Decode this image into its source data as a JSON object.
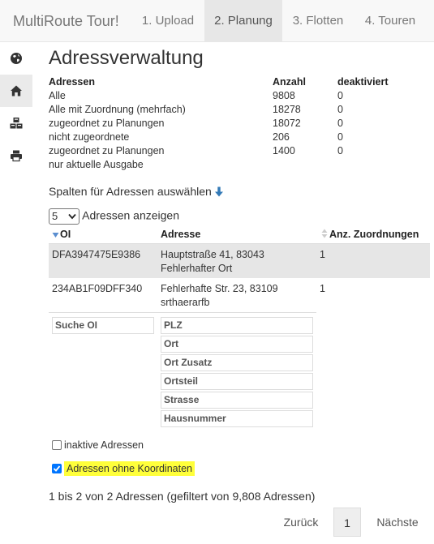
{
  "navbar": {
    "brand": "MultiRoute Tour!",
    "tabs": [
      "1. Upload",
      "2. Planung",
      "3. Flotten",
      "4. Touren"
    ],
    "active_tab": 1
  },
  "sidebar": {
    "items": [
      "globe-icon",
      "home-icon",
      "cubes-icon",
      "print-icon"
    ],
    "active_item": 1
  },
  "page": {
    "title": "Adressverwaltung"
  },
  "summary": {
    "headers": [
      "Adressen",
      "Anzahl",
      "deaktiviert"
    ],
    "rows": [
      [
        "Alle",
        "9808",
        "0"
      ],
      [
        "Alle mit Zuordnung (mehrfach)",
        "18278",
        "0"
      ],
      [
        "zugeordnet zu Planungen",
        "18072",
        "0"
      ],
      [
        "nicht zugeordnete",
        "206",
        "0"
      ],
      [
        "zugeordnet zu Planungen",
        "1400",
        "0"
      ],
      [
        "nur aktuelle Ausgabe",
        "",
        ""
      ]
    ]
  },
  "columns_selector": {
    "label": "Spalten für Adressen auswählen"
  },
  "length_control": {
    "value": "5",
    "label": "Adressen anzeigen"
  },
  "table": {
    "headers": [
      "OI",
      "Adresse",
      "Anz. Zuordnungen"
    ],
    "rows": [
      {
        "oi": "DFA3947475E9386",
        "address_line1": "Hauptstraße 41, 83043",
        "address_line2": "Fehlerhafter Ort",
        "count": "1"
      },
      {
        "oi": "234AB1F09DFF340",
        "address_line1": "Fehlerhafte Str. 23, 83109",
        "address_line2": "srthaerarfb",
        "count": "1"
      }
    ],
    "filters": {
      "oi_placeholder": "Suche OI",
      "address_placeholders": [
        "PLZ",
        "Ort",
        "Ort Zusatz",
        "Ortsteil",
        "Strasse",
        "Hausnummer"
      ]
    }
  },
  "checkboxes": {
    "inactive": {
      "label": "inaktive Adressen",
      "checked": false
    },
    "no_coords": {
      "label": "Adressen ohne Koordinaten",
      "checked": true,
      "highlight_color": "#ffff3a"
    }
  },
  "info": {
    "text": "1 bis 2 von 2 Adressen (gefiltert von 9,808 Adressen)"
  },
  "pagination": {
    "previous": "Zurück",
    "current": "1",
    "next": "Nächste"
  },
  "colors": {
    "accent": "#337ab7",
    "checkbox": "#0075ff"
  }
}
